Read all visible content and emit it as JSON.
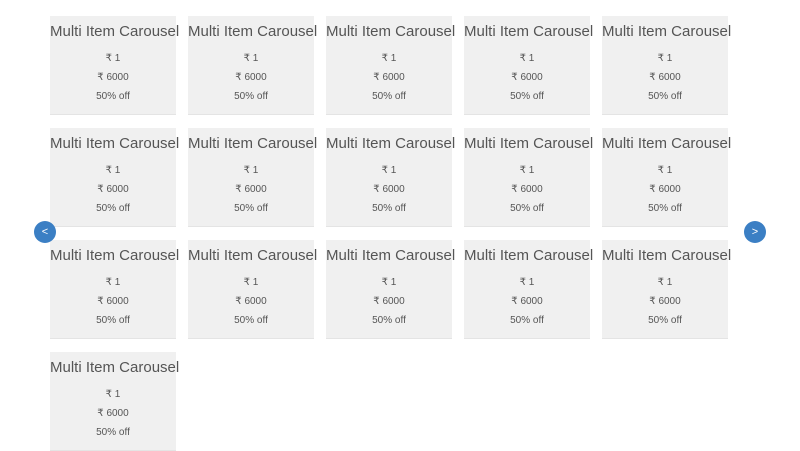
{
  "carousel": {
    "prev_label": "<",
    "next_label": ">",
    "items": [
      {
        "title": "Multi Item Carousel",
        "price": "₹ 1",
        "mrp": "₹ 6000",
        "discount": "50% off"
      },
      {
        "title": "Multi Item Carousel",
        "price": "₹ 1",
        "mrp": "₹ 6000",
        "discount": "50% off"
      },
      {
        "title": "Multi Item Carousel",
        "price": "₹ 1",
        "mrp": "₹ 6000",
        "discount": "50% off"
      },
      {
        "title": "Multi Item Carousel",
        "price": "₹ 1",
        "mrp": "₹ 6000",
        "discount": "50% off"
      },
      {
        "title": "Multi Item Carousel",
        "price": "₹ 1",
        "mrp": "₹ 6000",
        "discount": "50% off"
      },
      {
        "title": "Multi Item Carousel",
        "price": "₹ 1",
        "mrp": "₹ 6000",
        "discount": "50% off"
      },
      {
        "title": "Multi Item Carousel",
        "price": "₹ 1",
        "mrp": "₹ 6000",
        "discount": "50% off"
      },
      {
        "title": "Multi Item Carousel",
        "price": "₹ 1",
        "mrp": "₹ 6000",
        "discount": "50% off"
      },
      {
        "title": "Multi Item Carousel",
        "price": "₹ 1",
        "mrp": "₹ 6000",
        "discount": "50% off"
      },
      {
        "title": "Multi Item Carousel",
        "price": "₹ 1",
        "mrp": "₹ 6000",
        "discount": "50% off"
      },
      {
        "title": "Multi Item Carousel",
        "price": "₹ 1",
        "mrp": "₹ 6000",
        "discount": "50% off"
      },
      {
        "title": "Multi Item Carousel",
        "price": "₹ 1",
        "mrp": "₹ 6000",
        "discount": "50% off"
      },
      {
        "title": "Multi Item Carousel",
        "price": "₹ 1",
        "mrp": "₹ 6000",
        "discount": "50% off"
      },
      {
        "title": "Multi Item Carousel",
        "price": "₹ 1",
        "mrp": "₹ 6000",
        "discount": "50% off"
      },
      {
        "title": "Multi Item Carousel",
        "price": "₹ 1",
        "mrp": "₹ 6000",
        "discount": "50% off"
      },
      {
        "title": "Multi Item Carousel",
        "price": "₹ 1",
        "mrp": "₹ 6000",
        "discount": "50% off"
      }
    ]
  },
  "colors": {
    "card_background": "#f0f0f0",
    "nav_button": "#3b7fc4",
    "text": "#555555"
  },
  "icons": {
    "prev": "chevron-left-icon",
    "next": "chevron-right-icon"
  }
}
